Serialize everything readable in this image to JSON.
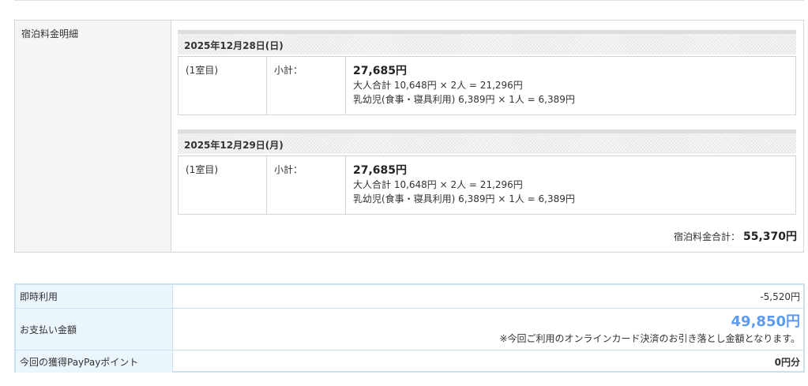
{
  "fee_breakdown": {
    "label": "宿泊料金明細",
    "days": [
      {
        "date": "2025年12月28日(日)",
        "room": "(1室目)",
        "subtotal_label": "小計：",
        "subtotal": "27,685円",
        "adult_line": "大人合計 10,648円 × 2人 = 21,296円",
        "infant_line": "乳幼児(食事・寝具利用) 6,389円 × 1人 = 6,389円"
      },
      {
        "date": "2025年12月29日(月)",
        "room": "(1室目)",
        "subtotal_label": "小計：",
        "subtotal": "27,685円",
        "adult_line": "大人合計 10,648円 × 2人 = 21,296円",
        "infant_line": "乳幼児(食事・寝具利用) 6,389円 × 1人 = 6,389円"
      }
    ],
    "grand_total_label": "宿泊料金合計：",
    "grand_total": "55,370円"
  },
  "payment": {
    "instant_use_label": "即時利用",
    "instant_use_value": "-5,520円",
    "payment_amount_label": "お支払い金額",
    "payment_amount_value": "49,850円",
    "payment_note": "※今回ご利用のオンラインカード決済のお引き落とし金額となります。",
    "points_label": "今回の獲得PayPayポイント",
    "points_value": "0円分"
  },
  "colors": {
    "accent_amount": "#5b9bf0",
    "payment_border": "#cbe0ef",
    "payment_label_bg": "#ebf5fc"
  }
}
